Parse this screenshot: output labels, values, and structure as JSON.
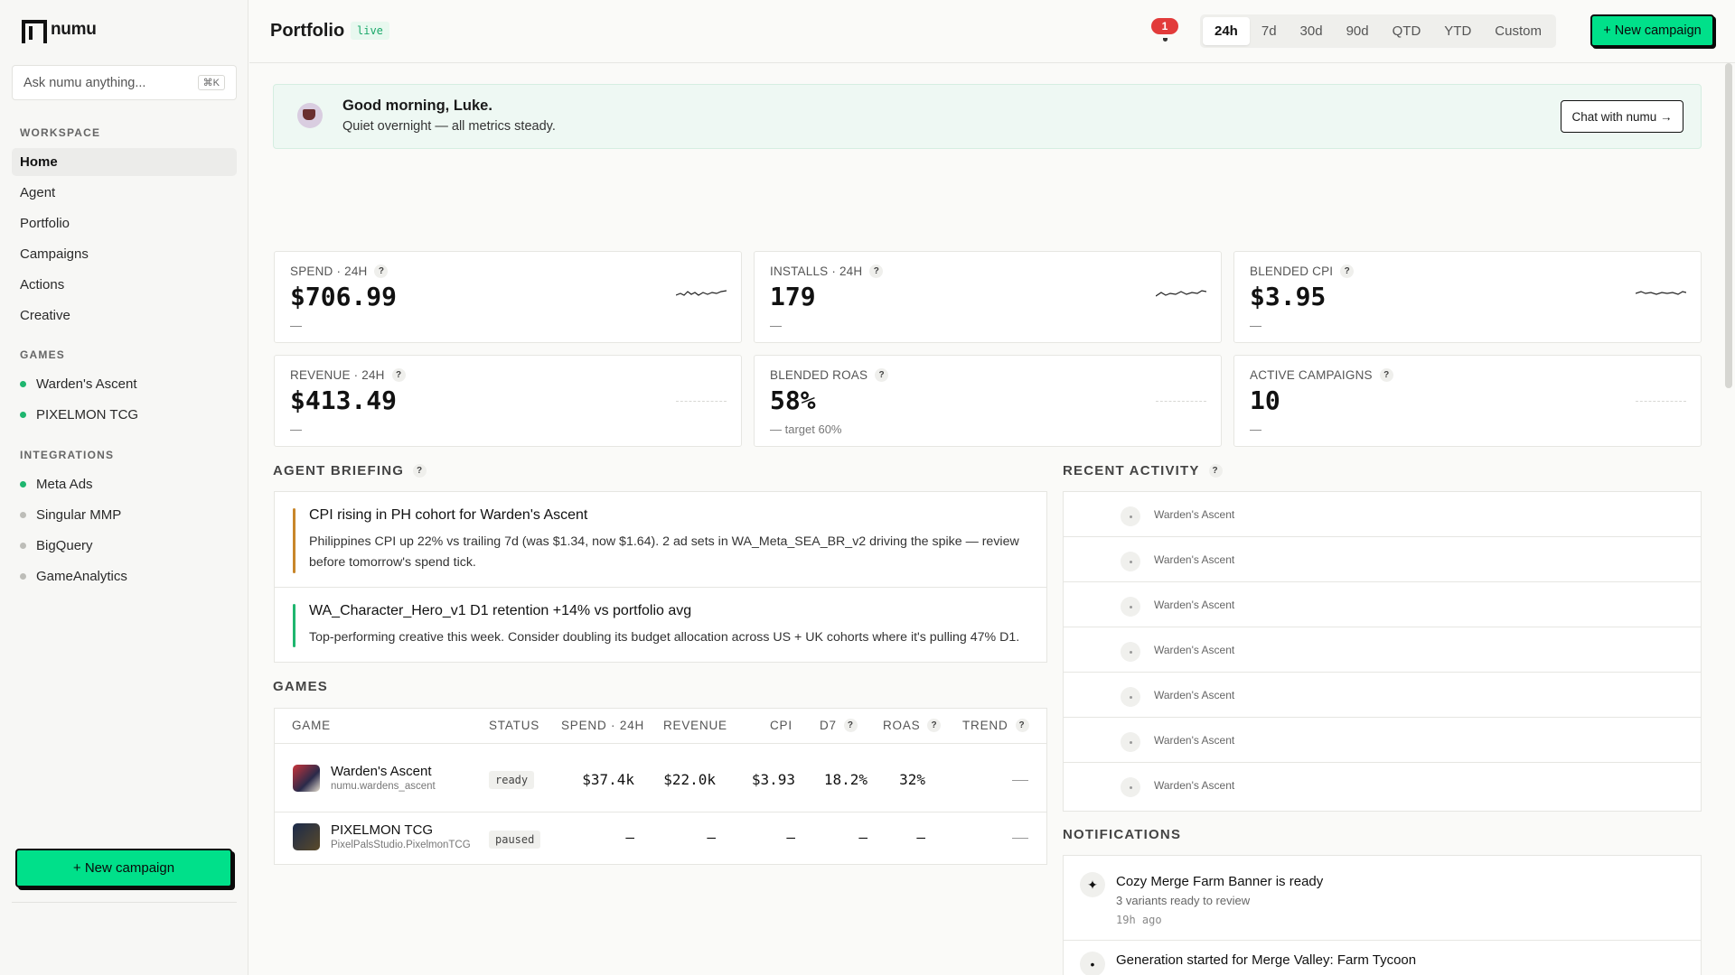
{
  "app": {
    "name": "numu"
  },
  "sidebar": {
    "ask_placeholder": "Ask numu anything...",
    "ask_shortcut": "⌘K",
    "workspace_label": "WORKSPACE",
    "nav": [
      {
        "label": "Home",
        "active": true
      },
      {
        "label": "Agent"
      },
      {
        "label": "Portfolio"
      },
      {
        "label": "Campaigns"
      },
      {
        "label": "Actions"
      },
      {
        "label": "Creative"
      }
    ],
    "games_label": "GAMES",
    "games": [
      {
        "label": "Warden's Ascent",
        "color": "#1fb66f"
      },
      {
        "label": "PIXELMON TCG",
        "color": "#1fb66f"
      }
    ],
    "integrations_label": "INTEGRATIONS",
    "integrations": [
      {
        "label": "Meta Ads",
        "color": "#1fb66f"
      },
      {
        "label": "Singular MMP",
        "color": "#bdbdb8"
      },
      {
        "label": "BigQuery",
        "color": "#bdbdb8"
      },
      {
        "label": "GameAnalytics",
        "color": "#bdbdb8"
      }
    ],
    "cta": "+ New campaign"
  },
  "topbar": {
    "title": "Portfolio",
    "live_badge": "live",
    "notification_count": "1",
    "ranges": [
      "24h",
      "7d",
      "30d",
      "90d",
      "QTD",
      "YTD",
      "Custom"
    ],
    "active_range": "24h",
    "cta": "+ New campaign"
  },
  "greeting": {
    "title": "Good morning, Luke.",
    "subtitle": "Quiet overnight — all metrics steady.",
    "button": "Chat with numu →"
  },
  "metrics": [
    {
      "label": "SPEND · 24H",
      "value": "$706.99",
      "sub": "—"
    },
    {
      "label": "INSTALLS · 24H",
      "value": "179",
      "sub": "—"
    },
    {
      "label": "BLENDED CPI",
      "value": "$3.95",
      "sub": "—"
    },
    {
      "label": "REVENUE · 24H",
      "value": "$413.49",
      "sub": "—"
    },
    {
      "label": "BLENDED ROAS",
      "value": "58%",
      "sub": "—  target 60%"
    },
    {
      "label": "ACTIVE CAMPAIGNS",
      "value": "10",
      "sub": "—"
    }
  ],
  "briefing": {
    "title": "AGENT BRIEFING",
    "items": [
      {
        "title": "CPI rising in PH cohort for Warden's Ascent",
        "body": "Philippines CPI up 22% vs trailing 7d (was $1.34, now $1.64). 2 ad sets in WA_Meta_SEA_BR_v2 driving the spike — review before tomorrow's spend tick.",
        "color": "#c8862a"
      },
      {
        "title": "WA_Character_Hero_v1 D1 retention +14% vs portfolio avg",
        "body": "Top-performing creative this week. Consider doubling its budget allocation across US + UK cohorts where it's pulling 47% D1.",
        "color": "#1fb66f"
      }
    ]
  },
  "games_table": {
    "title": "GAMES",
    "headers": [
      "GAME",
      "STATUS",
      "SPEND · 24H",
      "REVENUE",
      "CPI",
      "D7",
      "ROAS",
      "TREND"
    ],
    "rows": [
      {
        "name": "Warden's Ascent",
        "id": "numu.wardens_ascent",
        "status": "ready",
        "spend": "$37.4k",
        "revenue": "$22.0k",
        "cpi": "$3.93",
        "d7": "18.2%",
        "roas": "32%",
        "trend": "—"
      },
      {
        "name": "PIXELMON TCG",
        "id": "PixelPalsStudio.PixelmonTCG",
        "status": "paused",
        "spend": "—",
        "revenue": "—",
        "cpi": "—",
        "d7": "—",
        "roas": "—",
        "trend": "—"
      }
    ]
  },
  "activity": {
    "title": "RECENT ACTIVITY",
    "items": [
      "Warden's Ascent",
      "Warden's Ascent",
      "Warden's Ascent",
      "Warden's Ascent",
      "Warden's Ascent",
      "Warden's Ascent",
      "Warden's Ascent"
    ]
  },
  "notifications": {
    "title": "NOTIFICATIONS",
    "items": [
      {
        "title": "Cozy Merge Farm Banner is ready",
        "sub": "3 variants ready to review",
        "time": "19h ago"
      },
      {
        "title": "Generation started for Merge Valley: Farm Tycoon",
        "sub": "",
        "time": ""
      }
    ]
  }
}
